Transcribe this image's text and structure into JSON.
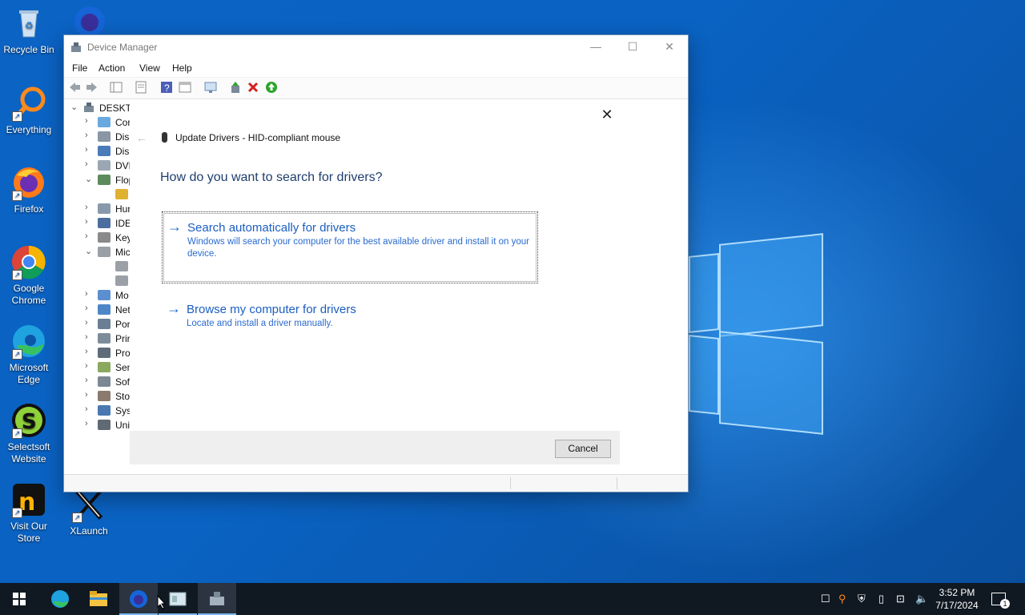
{
  "desktop": {
    "icons": [
      {
        "label": "Recycle Bin"
      },
      {
        "label": ""
      },
      {
        "label": "Everything"
      },
      {
        "label": "Firefox"
      },
      {
        "label": "Google Chrome"
      },
      {
        "label": "Microsoft Edge"
      },
      {
        "label": "Selectsoft Website"
      },
      {
        "label": "Visit Our Store"
      },
      {
        "label": "XLaunch"
      }
    ]
  },
  "window": {
    "title": "Device Manager",
    "controls": {
      "minimize": "—",
      "maximize": "☐",
      "close": "✕"
    },
    "menu": [
      "File",
      "Action",
      "View",
      "Help"
    ],
    "tree": {
      "root": "DESKTC",
      "items": [
        {
          "label": "Cor",
          "chev": "›"
        },
        {
          "label": "Disl",
          "chev": "›"
        },
        {
          "label": "Disp",
          "chev": "›"
        },
        {
          "label": "DVD",
          "chev": "›"
        },
        {
          "label": "Flop",
          "chev": "⌄"
        },
        {
          "label": "",
          "chev": ""
        },
        {
          "label": "Hur",
          "chev": "›"
        },
        {
          "label": "IDE",
          "chev": "›"
        },
        {
          "label": "Key",
          "chev": "›"
        },
        {
          "label": "Mic",
          "chev": "⌄"
        },
        {
          "label": "",
          "chev": ""
        },
        {
          "label": "",
          "chev": ""
        },
        {
          "label": "Mo",
          "chev": "›"
        },
        {
          "label": "Net",
          "chev": "›"
        },
        {
          "label": "Por",
          "chev": "›"
        },
        {
          "label": "Prir",
          "chev": "›"
        },
        {
          "label": "Pro",
          "chev": "›"
        },
        {
          "label": "Sen",
          "chev": "›"
        },
        {
          "label": "Sof",
          "chev": "›"
        },
        {
          "label": "Sto",
          "chev": "›"
        },
        {
          "label": "Sys",
          "chev": "›"
        },
        {
          "label": "Uni",
          "chev": "›"
        }
      ]
    }
  },
  "dialog": {
    "back_glyph": "←",
    "close_glyph": "✕",
    "header": "Update Drivers - HID-compliant mouse",
    "question": "How do you want to search for drivers?",
    "options": [
      {
        "arrow": "→",
        "title": "Search automatically for drivers",
        "description": "Windows will search your computer for the best available driver and install it on your device."
      },
      {
        "arrow": "→",
        "title": "Browse my computer for drivers",
        "description": "Locate and install a driver manually."
      }
    ],
    "cancel_label": "Cancel"
  },
  "taskbar": {
    "clock_time": "3:52 PM",
    "clock_date": "7/17/2024",
    "notification_count": "1"
  },
  "colors": {
    "accent": "#1b5ec1",
    "desktop": "#0a62c2",
    "taskbar": "#101922"
  }
}
